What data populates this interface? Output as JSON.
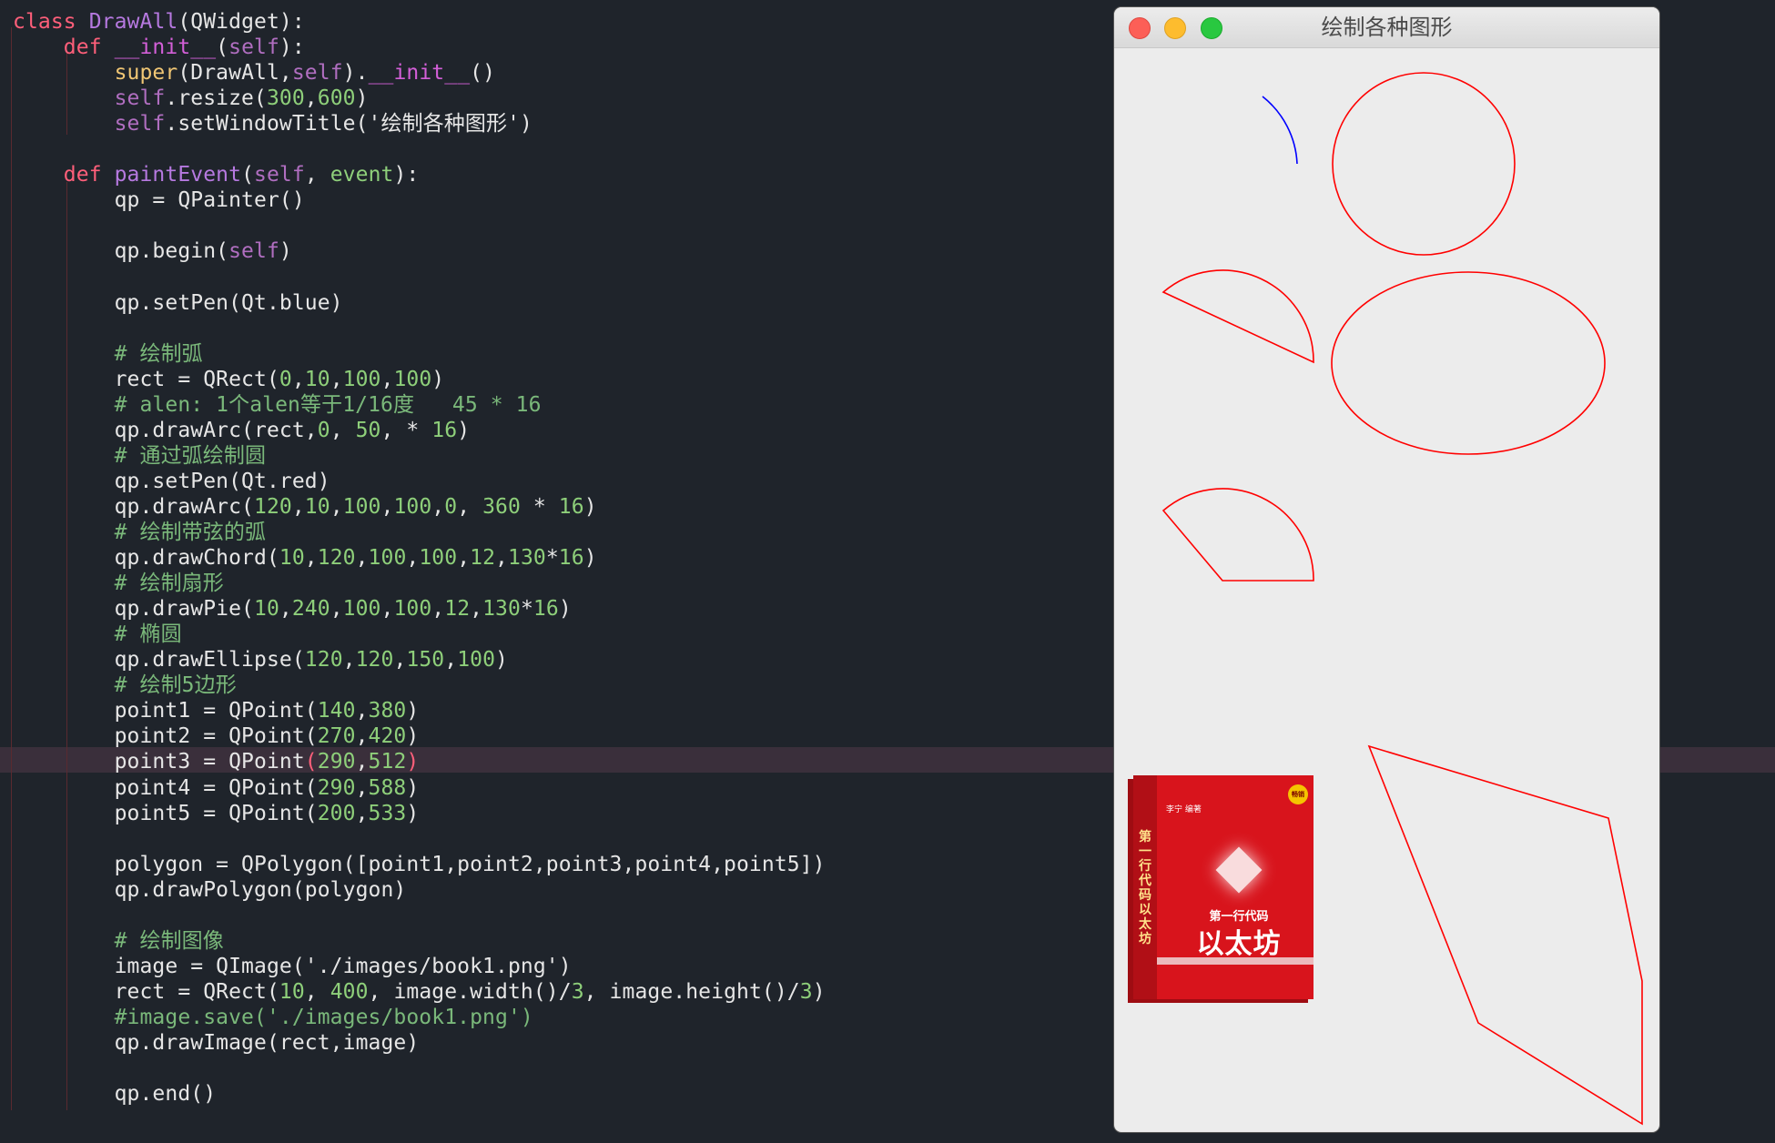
{
  "editor": {
    "lines": [
      [
        [
          "kw",
          "class"
        ],
        [
          "",
          " "
        ],
        [
          "cls",
          "DrawAll"
        ],
        [
          "",
          "(QWidget):"
        ]
      ],
      [
        [
          "",
          "    "
        ],
        [
          "kw",
          "def"
        ],
        [
          "",
          " "
        ],
        [
          "dun",
          "__init__"
        ],
        [
          "",
          "("
        ],
        [
          "slf",
          "self"
        ],
        [
          "",
          "):"
        ]
      ],
      [
        [
          "",
          "        "
        ],
        [
          "bi",
          "super"
        ],
        [
          "",
          "(DrawAll,"
        ],
        [
          "slf",
          "self"
        ],
        [
          "",
          ")."
        ],
        [
          "dun",
          "__init__"
        ],
        [
          "",
          "()"
        ]
      ],
      [
        [
          "",
          "        "
        ],
        [
          "slf",
          "self"
        ],
        [
          "",
          ".resize("
        ],
        [
          "num",
          "300"
        ],
        [
          "",
          ","
        ],
        [
          "num",
          "600"
        ],
        [
          "",
          ")"
        ]
      ],
      [
        [
          "",
          "        "
        ],
        [
          "slf",
          "self"
        ],
        [
          "",
          ".setWindowTitle('绘制各种图形')"
        ]
      ],
      [
        [
          "",
          ""
        ]
      ],
      [
        [
          "",
          "    "
        ],
        [
          "kw",
          "def"
        ],
        [
          "",
          " "
        ],
        [
          "fn",
          "paintEvent"
        ],
        [
          "",
          "("
        ],
        [
          "slf",
          "self"
        ],
        [
          "",
          ", "
        ],
        [
          "num",
          "event"
        ],
        [
          "",
          "):"
        ]
      ],
      [
        [
          "",
          "        qp = QPainter()"
        ]
      ],
      [
        [
          "",
          ""
        ]
      ],
      [
        [
          "",
          "        qp.begin("
        ],
        [
          "slf",
          "self"
        ],
        [
          "",
          ")"
        ]
      ],
      [
        [
          "",
          ""
        ]
      ],
      [
        [
          "",
          "        qp.setPen(Qt.blue)"
        ]
      ],
      [
        [
          "",
          ""
        ]
      ],
      [
        [
          "",
          "        "
        ],
        [
          "cm",
          "# 绘制弧"
        ]
      ],
      [
        [
          "",
          "        rect = QRect("
        ],
        [
          "num",
          "0"
        ],
        [
          "",
          ","
        ],
        [
          "num",
          "10"
        ],
        [
          "",
          ","
        ],
        [
          "num",
          "100"
        ],
        [
          "",
          ","
        ],
        [
          "num",
          "100"
        ],
        [
          "",
          ")"
        ]
      ],
      [
        [
          "",
          "        "
        ],
        [
          "cm",
          "# alen: 1个alen等于1/16度   45 * 16"
        ]
      ],
      [
        [
          "",
          "        qp.drawArc(rect,"
        ],
        [
          "num",
          "0"
        ],
        [
          "",
          ", "
        ],
        [
          "num",
          "50"
        ],
        [
          "",
          ", * "
        ],
        [
          "num",
          "16"
        ],
        [
          "",
          ")"
        ]
      ],
      [
        [
          "",
          "        "
        ],
        [
          "cm",
          "# 通过弧绘制圆"
        ]
      ],
      [
        [
          "",
          "        qp.setPen(Qt.red)"
        ]
      ],
      [
        [
          "",
          "        qp.drawArc("
        ],
        [
          "num",
          "120"
        ],
        [
          "",
          ","
        ],
        [
          "num",
          "10"
        ],
        [
          "",
          ","
        ],
        [
          "num",
          "100"
        ],
        [
          "",
          ","
        ],
        [
          "num",
          "100"
        ],
        [
          "",
          ","
        ],
        [
          "num",
          "0"
        ],
        [
          "",
          ", "
        ],
        [
          "num",
          "360"
        ],
        [
          "",
          " * "
        ],
        [
          "num",
          "16"
        ],
        [
          "",
          ")"
        ]
      ],
      [
        [
          "",
          "        "
        ],
        [
          "cm",
          "# 绘制带弦的弧"
        ]
      ],
      [
        [
          "",
          "        qp.drawChord("
        ],
        [
          "num",
          "10"
        ],
        [
          "",
          ","
        ],
        [
          "num",
          "120"
        ],
        [
          "",
          ","
        ],
        [
          "num",
          "100"
        ],
        [
          "",
          ","
        ],
        [
          "num",
          "100"
        ],
        [
          "",
          ","
        ],
        [
          "num",
          "12"
        ],
        [
          "",
          ","
        ],
        [
          "num",
          "130"
        ],
        [
          "",
          "*"
        ],
        [
          "num",
          "16"
        ],
        [
          "",
          ")"
        ]
      ],
      [
        [
          "",
          "        "
        ],
        [
          "cm",
          "# 绘制扇形"
        ]
      ],
      [
        [
          "",
          "        qp.drawPie("
        ],
        [
          "num",
          "10"
        ],
        [
          "",
          ","
        ],
        [
          "num",
          "240"
        ],
        [
          "",
          ","
        ],
        [
          "num",
          "100"
        ],
        [
          "",
          ","
        ],
        [
          "num",
          "100"
        ],
        [
          "",
          ","
        ],
        [
          "num",
          "12"
        ],
        [
          "",
          ","
        ],
        [
          "num",
          "130"
        ],
        [
          "",
          "*"
        ],
        [
          "num",
          "16"
        ],
        [
          "",
          ")"
        ]
      ],
      [
        [
          "",
          "        "
        ],
        [
          "cm",
          "# 椭圆"
        ]
      ],
      [
        [
          "",
          "        qp.drawEllipse("
        ],
        [
          "num",
          "120"
        ],
        [
          "",
          ","
        ],
        [
          "num",
          "120"
        ],
        [
          "",
          ","
        ],
        [
          "num",
          "150"
        ],
        [
          "",
          ","
        ],
        [
          "num",
          "100"
        ],
        [
          "",
          ")"
        ]
      ],
      [
        [
          "",
          "        "
        ],
        [
          "cm",
          "# 绘制5边形"
        ]
      ],
      [
        [
          "",
          "        point1 = QPoint("
        ],
        [
          "num",
          "140"
        ],
        [
          "",
          ","
        ],
        [
          "num",
          "380"
        ],
        [
          "",
          ")"
        ]
      ],
      [
        [
          "",
          "        point2 = QPoint("
        ],
        [
          "num",
          "270"
        ],
        [
          "",
          ","
        ],
        [
          "num",
          "420"
        ],
        [
          "",
          ")"
        ]
      ],
      [
        [
          "",
          "        point3 = QPoint"
        ],
        [
          "kw",
          "("
        ],
        [
          "num",
          "290"
        ],
        [
          "",
          ","
        ],
        [
          "num",
          "512"
        ],
        [
          "kw",
          ")"
        ]
      ],
      [
        [
          "",
          "        point4 = QPoint("
        ],
        [
          "num",
          "290"
        ],
        [
          "",
          ","
        ],
        [
          "num",
          "588"
        ],
        [
          "",
          ")"
        ]
      ],
      [
        [
          "",
          "        point5 = QPoint("
        ],
        [
          "num",
          "200"
        ],
        [
          "",
          ","
        ],
        [
          "num",
          "533"
        ],
        [
          "",
          ")"
        ]
      ],
      [
        [
          "",
          ""
        ]
      ],
      [
        [
          "",
          "        polygon = QPolygon([point1,point2,point3,point4,point5])"
        ]
      ],
      [
        [
          "",
          "        qp.drawPolygon(polygon)"
        ]
      ],
      [
        [
          "",
          ""
        ]
      ],
      [
        [
          "",
          "        "
        ],
        [
          "cm",
          "# 绘制图像"
        ]
      ],
      [
        [
          "",
          "        image = QImage('./images/book1.png')"
        ]
      ],
      [
        [
          "",
          "        rect = QRect("
        ],
        [
          "num",
          "10"
        ],
        [
          "",
          ", "
        ],
        [
          "num",
          "400"
        ],
        [
          "",
          ", image.width()/"
        ],
        [
          "num",
          "3"
        ],
        [
          "",
          ", image.height()/"
        ],
        [
          "num",
          "3"
        ],
        [
          "",
          ")"
        ]
      ],
      [
        [
          "",
          "        "
        ],
        [
          "cm",
          "#image.save('./images/book1.png')"
        ]
      ],
      [
        [
          "",
          "        qp.drawImage(rect,image)"
        ]
      ],
      [
        [
          "",
          ""
        ]
      ],
      [
        [
          "",
          "        qp.end()"
        ]
      ]
    ]
  },
  "window": {
    "title": "绘制各种图形",
    "close_label": "close",
    "minimize_label": "minimize",
    "zoom_label": "zoom"
  },
  "book": {
    "spine_text": "第一行代码以太坊",
    "author": "李宁 编著",
    "badge": "畅销",
    "subtitle": "第一行代码",
    "title": "以太坊"
  },
  "colors": {
    "arc_blue": "#0000ff",
    "shape_red": "#ff0000",
    "editor_bg": "#1f242b"
  }
}
